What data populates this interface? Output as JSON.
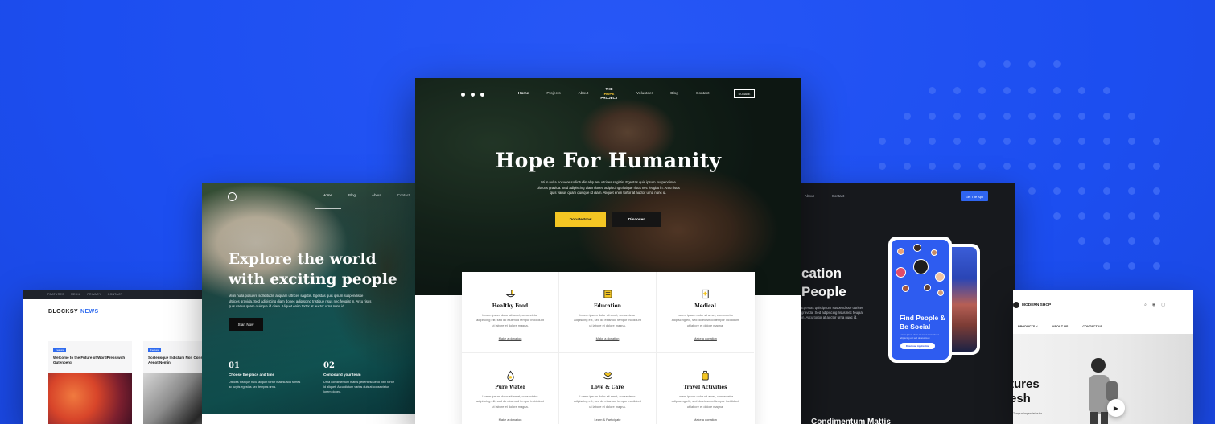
{
  "colors": {
    "background": "#1c4ef0",
    "accent_yellow": "#f4c623",
    "app_blue": "#2f65f0"
  },
  "blog_card": {
    "topbar": [
      "FEATURES",
      "MEDIA",
      "PRIVACY",
      "CONTACT"
    ],
    "logo_main": "BLOCKSY",
    "logo_accent": "NEWS",
    "posts": [
      {
        "tag": "Feature",
        "title": "Welcome to the Future of WordPress with Gutenberg"
      },
      {
        "tag": "Feature",
        "title": "Scelerisque Indictum Non Consectetur Aenot Nemin"
      }
    ]
  },
  "travel_card": {
    "nav": [
      "Home",
      "Blog",
      "About",
      "Contact"
    ],
    "heading_line1": "Explore the world",
    "heading_line2": "with exciting people",
    "body": "Mi in nulla posuere sollicitudin aliquam ultrices sagittis. Egestas quis ipsum suspendisse ultrices gravida. Sed adipiscing diam donec adipiscing tristique risus nec feugiat in. Arcu risus quis varius quam quisque id diam. Aliquet enim tortor at auctor urna nunc id.",
    "button": "Start Now",
    "features": [
      {
        "num": "01",
        "title": "Choose the place and time",
        "text": "Ultrices tristique nulla aliquet tortor malesuada fames ac turpis egestas sed tempus urna."
      },
      {
        "num": "02",
        "title": "Compound your team",
        "text": "Urna condimentum mattis pellentesque id nibh tortor id aliquet. Arcu dictum varius duis at consectetur lorem donec."
      }
    ]
  },
  "main_card": {
    "social_icons": [
      "facebook-icon",
      "twitter-icon",
      "pinterest-icon"
    ],
    "nav_left": [
      "Home",
      "Projects",
      "About"
    ],
    "nav_right": [
      "Volunteer",
      "Blog",
      "Contact"
    ],
    "logo_line1": "THE",
    "logo_line2": "HOPE",
    "logo_line3": "PROJECT",
    "donate_button": "DONATE",
    "title": "Hope For Humanity",
    "description": "Mi in nulla posuere sollicitudin aliquam ultrices sagittis. Egestas quis ipsum suspendisse ultrices gravida. Sed adipiscing diam donec adipiscing tristique risus nec feugiat in. Arcu risus quis varius quam quisque id diam. Aliquet enim tortor at auctor urna nunc id.",
    "primary_button": "Donate Now",
    "secondary_button": "Discover",
    "causes": [
      {
        "icon": "food-icon",
        "title": "Healthy Food",
        "text": "Lorem ipsum dolor sit amet, consectetur adipiscing elit, sed do eiusmod tempor incididunt ut labore et dolore magna.",
        "link": "Make a donation"
      },
      {
        "icon": "education-icon",
        "title": "Education",
        "text": "Lorem ipsum dolor sit amet, consectetur adipiscing elit, sed do eiusmod tempor incididunt ut labore et dolore magna.",
        "link": "Make a donation"
      },
      {
        "icon": "medical-icon",
        "title": "Medical",
        "text": "Lorem ipsum dolor sit amet, consectetur adipiscing elit, sed do eiusmod tempor incididunt ut labore et dolore magna.",
        "link": "Make a donation"
      },
      {
        "icon": "water-icon",
        "title": "Pure Water",
        "text": "Lorem ipsum dolor sit amet, consectetur adipiscing elit, sed do eiusmod tempor incididunt ut labore et dolore magna.",
        "link": "Make a donation"
      },
      {
        "icon": "love-icon",
        "title": "Love & Care",
        "text": "Lorem ipsum dolor sit amet, consectetur adipiscing elit, sed do eiusmod tempor incididunt ut labore et dolore magna.",
        "link": "Learn & Participate"
      },
      {
        "icon": "travel-icon",
        "title": "Travel Activities",
        "text": "Lorem ipsum dolor sit amet, consectetur adipiscing elit, sed do eiusmod tempor incididunt ut labore et dolore magna.",
        "link": "Make a donation"
      }
    ]
  },
  "app_card": {
    "nav": [
      "About",
      "Contact"
    ],
    "get_button": "Get The App",
    "heading_line1": "cation",
    "heading_line2": "People",
    "body": "Egestas quis ipsum suspendisse ultrices gravida. Sed adipiscing risus nec feugiat in. Arcu tortor at auctor urna nunc id.",
    "phone_title_line1": "Find People &",
    "phone_title_line2": "Be Social",
    "phone_subtitle": "Lorem ipsum dolor sit amet consectetur adipiscing elit sed do eiusmod.",
    "phone_button": "Download Application",
    "bottom_title": "Condimentum Mattis"
  },
  "shop_card": {
    "logo": "MODERN SHOP",
    "icons": [
      "search-icon",
      "user-icon",
      "cart-icon"
    ],
    "menu": [
      "PRODUCTS ˅",
      "ABOUT US",
      "CONTACT US"
    ],
    "heading_line1": "tures",
    "heading_line2": "esh",
    "sub": "Tempus imperdiet nulla"
  }
}
